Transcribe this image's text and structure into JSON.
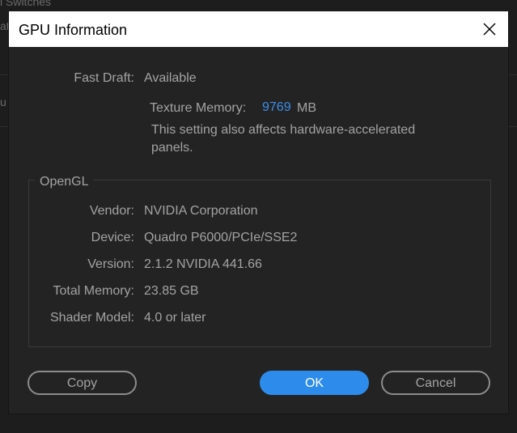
{
  "background": {
    "fragment_1": "l Switches",
    "fragment_2": "at",
    "fragment_3": "u"
  },
  "dialog": {
    "title": "GPU Information",
    "close_icon": "close-x-icon"
  },
  "fast_draft": {
    "label": "Fast Draft:",
    "value": "Available"
  },
  "texture_memory": {
    "label": "Texture Memory:",
    "value": "9769",
    "unit": "MB",
    "note": "This setting also affects hardware-accelerated panels."
  },
  "opengl": {
    "group_title": "OpenGL",
    "rows": [
      {
        "label": "Vendor:",
        "value": "NVIDIA Corporation"
      },
      {
        "label": "Device:",
        "value": "Quadro P6000/PCIe/SSE2"
      },
      {
        "label": "Version:",
        "value": "2.1.2 NVIDIA 441.66"
      },
      {
        "label": "Total Memory:",
        "value": "23.85 GB"
      },
      {
        "label": "Shader Model:",
        "value": "4.0 or later"
      }
    ]
  },
  "buttons": {
    "copy": "Copy",
    "ok": "OK",
    "cancel": "Cancel"
  },
  "colors": {
    "accent": "#2d8ceb",
    "memory_value": "#3a8eea",
    "dialog_bg": "#232323",
    "text": "#a3a3a3"
  }
}
